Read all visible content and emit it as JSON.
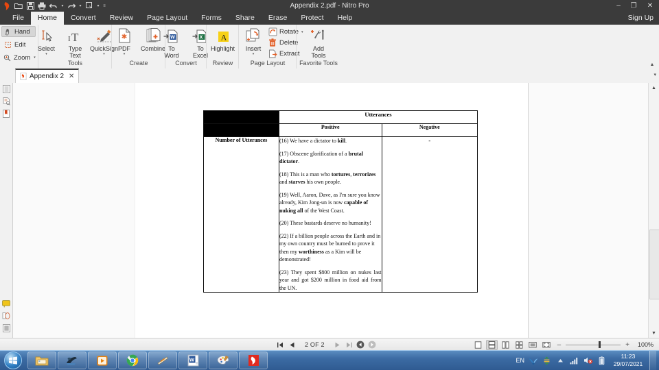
{
  "window": {
    "title": "Appendix 2.pdf - Nitro Pro",
    "minimize": "–",
    "maximize": "❐",
    "close": "✕"
  },
  "quick_access": [
    {
      "name": "nitro-logo-icon",
      "label": "Nitro"
    },
    {
      "name": "open-icon",
      "label": "Open"
    },
    {
      "name": "save-icon",
      "label": "Save"
    },
    {
      "name": "print-icon",
      "label": "Print"
    },
    {
      "name": "undo-icon",
      "label": "Undo"
    },
    {
      "name": "redo-icon",
      "label": "Redo"
    },
    {
      "name": "customize-icon",
      "label": "Customize"
    }
  ],
  "menubar": {
    "items": [
      "File",
      "Home",
      "Convert",
      "Review",
      "Page Layout",
      "Forms",
      "Share",
      "Erase",
      "Protect",
      "Help"
    ],
    "active": "Home",
    "sign_up": "Sign Up"
  },
  "ribbon": {
    "modes": [
      {
        "label": "Hand",
        "icon": "hand-icon",
        "selected": true
      },
      {
        "label": "Edit",
        "icon": "edit-icon",
        "selected": false
      },
      {
        "label": "Zoom",
        "icon": "zoom-icon",
        "selected": false,
        "caret": "▾"
      }
    ],
    "groups": [
      {
        "label": "Tools",
        "buttons": [
          {
            "label_top": "Select",
            "label_bottom": "",
            "icon": "select-cursor-icon",
            "caret": "▾"
          },
          {
            "label_top": "Type",
            "label_bottom": "Text",
            "icon": "type-text-icon",
            "caret": ""
          },
          {
            "label_top": "QuickSign",
            "label_bottom": "",
            "icon": "quicksign-pen-icon",
            "caret": "▾"
          }
        ]
      },
      {
        "label": "Create",
        "buttons": [
          {
            "label_top": "PDF",
            "label_bottom": "",
            "icon": "pdf-create-icon",
            "caret": "▾"
          },
          {
            "label_top": "Combine",
            "label_bottom": "",
            "icon": "combine-icon",
            "caret": ""
          }
        ]
      },
      {
        "label": "Convert",
        "buttons": [
          {
            "label_top": "To",
            "label_bottom": "Word",
            "icon": "to-word-icon",
            "caret": ""
          },
          {
            "label_top": "To",
            "label_bottom": "Excel",
            "icon": "to-excel-icon",
            "caret": ""
          }
        ]
      },
      {
        "label": "Review",
        "buttons": [
          {
            "label_top": "Highlight",
            "label_bottom": "",
            "icon": "highlight-icon",
            "caret": ""
          }
        ]
      },
      {
        "label": "Page Layout",
        "buttons": [
          {
            "label_top": "Insert",
            "label_bottom": "",
            "icon": "insert-pages-icon",
            "caret": "▾"
          }
        ],
        "small_buttons": [
          {
            "label": "Rotate",
            "icon": "rotate-icon",
            "caret": "▾"
          },
          {
            "label": "Delete",
            "icon": "delete-pages-icon",
            "caret": ""
          },
          {
            "label": "Extract",
            "icon": "extract-pages-icon",
            "caret": ""
          }
        ]
      },
      {
        "label": "Favorite Tools",
        "buttons": [
          {
            "label_top": "Add",
            "label_bottom": "Tools",
            "icon": "add-tools-icon",
            "caret": ""
          }
        ]
      }
    ],
    "collapse_caret": "▲"
  },
  "tabstrip": {
    "tab_label": "Appendix 2",
    "tab_close": "✕",
    "overflow_caret": "▾"
  },
  "rail": {
    "top_icons": [
      "pages-panel-icon",
      "comments-panel-icon",
      "bookmarks-panel-icon"
    ],
    "bottom_icons": [
      "sticky-note-icon",
      "stamp-icon",
      "page-thumbnail-icon"
    ]
  },
  "document": {
    "table": {
      "header_top": {
        "corner": "",
        "utterances": "Utterances"
      },
      "header_sub": {
        "corner": "",
        "positive": "Positive",
        "negative": "Negative"
      },
      "row_label": "Number of Utterances",
      "negative_value": "-",
      "positive_utterances": [
        {
          "id": "16",
          "parts": [
            {
              "t": "(16) We have a dictator to ",
              "b": false
            },
            {
              "t": "kill",
              "b": true
            },
            {
              "t": ".",
              "b": false
            }
          ],
          "justify": false
        },
        {
          "id": "17",
          "parts": [
            {
              "t": "(17) Obscene glorification of a ",
              "b": false
            },
            {
              "t": "brutal dictator",
              "b": true
            },
            {
              "t": ".",
              "b": false
            }
          ],
          "justify": false
        },
        {
          "id": "18",
          "parts": [
            {
              "t": "(18) This is a man who ",
              "b": false
            },
            {
              "t": "tortures",
              "b": true
            },
            {
              "t": ", ",
              "b": false
            },
            {
              "t": "terrorizes",
              "b": true
            },
            {
              "t": " and ",
              "b": false
            },
            {
              "t": "starves",
              "b": true
            },
            {
              "t": " his own people.",
              "b": false
            }
          ],
          "justify": false
        },
        {
          "id": "19",
          "parts": [
            {
              "t": "(19) Well, Aaron, Dave, as I'm sure you know already, Kim Jong-un is now ",
              "b": false
            },
            {
              "t": "capable of nuking all",
              "b": true
            },
            {
              "t": " of the West Coast.",
              "b": false
            }
          ],
          "justify": false
        },
        {
          "id": "20",
          "parts": [
            {
              "t": "(20) These bastards deserve no humanity!",
              "b": false
            }
          ],
          "justify": false
        },
        {
          "id": "22",
          "parts": [
            {
              "t": "(22) If a billion people across the Earth and in my own country must be burned to prove it then my ",
              "b": false
            },
            {
              "t": "worthiness",
              "b": true
            },
            {
              "t": " as a Kim will be demonstrated!",
              "b": false
            }
          ],
          "justify": false
        },
        {
          "id": "23",
          "parts": [
            {
              "t": "(23) They spent $800 million on nukes last year and got $200 million in food aid from the UN.",
              "b": false
            }
          ],
          "justify": true
        }
      ]
    }
  },
  "statusbar": {
    "first_page": "first-page-icon",
    "prev_page": "previous-page-icon",
    "page_indicator": "2 OF 2",
    "next_page": "next-page-icon",
    "last_page": "last-page-icon",
    "prev_view": "previous-view-icon",
    "next_view": "next-view-icon",
    "view_modes": [
      {
        "name": "single-page-view-icon",
        "selected": false
      },
      {
        "name": "continuous-view-icon",
        "selected": true
      },
      {
        "name": "two-page-view-icon",
        "selected": false
      },
      {
        "name": "two-page-continuous-view-icon",
        "selected": false
      },
      {
        "name": "fit-width-icon",
        "selected": false
      },
      {
        "name": "full-screen-icon",
        "selected": false
      }
    ],
    "zoom_out": "–",
    "zoom_in": "+",
    "zoom_level": "100%"
  },
  "taskbar": {
    "start": "start-orb-icon",
    "items": [
      "file-explorer-icon",
      "notepad-icon",
      "media-player-icon",
      "chrome-icon",
      "winamp-icon",
      "word-icon",
      "paint-icon",
      "nitro-pro-icon"
    ],
    "tray": {
      "language": "EN",
      "icons": [
        "wifi-icon",
        "sync-icon",
        "show-hidden-icon",
        "signal-icon",
        "volume-muted-icon",
        "battery-icon"
      ],
      "time": "11:23",
      "date": "29/07/2021"
    }
  }
}
